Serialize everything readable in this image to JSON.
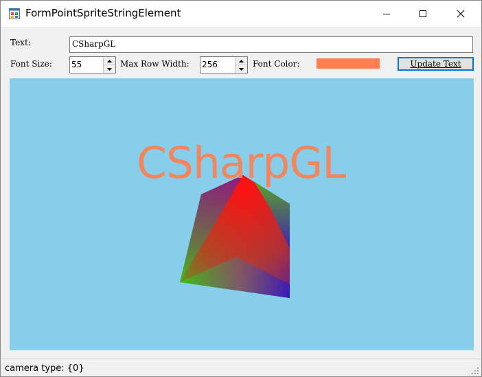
{
  "window": {
    "title": "FormPointSpriteStringElement"
  },
  "controls": {
    "text_label": "Text:",
    "text_value": "CSharpGL",
    "font_size_label": "Font Size:",
    "font_size_value": "55",
    "max_row_width_label": "Max Row Width:",
    "max_row_width_value": "256",
    "font_color_label": "Font Color:",
    "font_color_value": "#ff7f50",
    "update_button_label": "Update Text"
  },
  "viewport": {
    "background_color": "#87ceeb",
    "rendered_text": "CSharpGL",
    "rendered_text_color": "#ff7f50"
  },
  "status": {
    "text": "camera type: {0}"
  },
  "icons": {
    "app": "app-window-icon",
    "minimize": "minimize-icon",
    "maximize": "maximize-icon",
    "close": "close-icon",
    "spin_up": "spin-up-arrow-icon",
    "spin_down": "spin-down-arrow-icon",
    "grip": "resize-grip-icon"
  }
}
